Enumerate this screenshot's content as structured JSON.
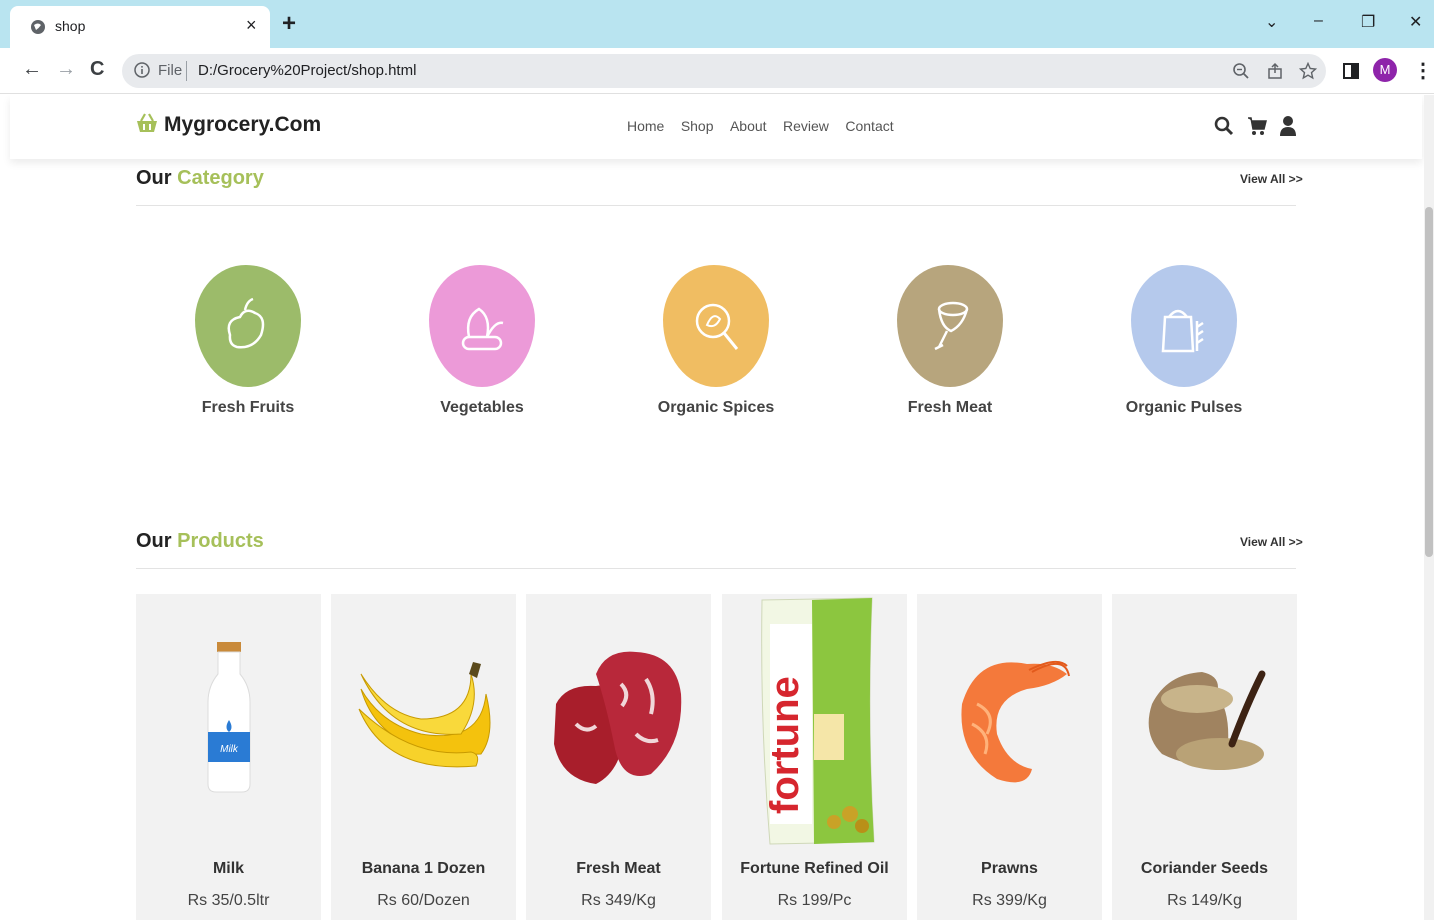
{
  "browser": {
    "tab_title": "shop",
    "address_prefix": "File",
    "url": "D:/Grocery%20Project/shop.html",
    "profile_initial": "M"
  },
  "site": {
    "logo": "Mygrocery.Com",
    "menu": [
      "Home",
      "Shop",
      "About",
      "Review",
      "Contact"
    ]
  },
  "category_section": {
    "title": "Our",
    "title_accent": "Category",
    "view_all": "View All >>",
    "items": [
      {
        "name": "Fresh Fruits",
        "color": "#9cbb6a",
        "icon": "fruit-icon"
      },
      {
        "name": "Vegetables",
        "color": "#ec9ad8",
        "icon": "vegetable-icon"
      },
      {
        "name": "Organic Spices",
        "color": "#f0bd62",
        "icon": "spice-icon"
      },
      {
        "name": "Fresh Meat",
        "color": "#b7a57d",
        "icon": "meat-icon"
      },
      {
        "name": "Organic Pulses",
        "color": "#b5c9ec",
        "icon": "pulse-icon"
      }
    ]
  },
  "products_section": {
    "title": "Our",
    "title_accent": "Products",
    "view_all": "View All >>",
    "items": [
      {
        "name": "Milk",
        "price": "Rs 35/0.5ltr",
        "image": "milk-bottle-icon"
      },
      {
        "name": "Banana 1 Dozen",
        "price": "Rs 60/Dozen",
        "image": "banana-icon"
      },
      {
        "name": "Fresh Meat",
        "price": "Rs 349/Kg",
        "image": "meat-icon"
      },
      {
        "name": "Fortune Refined Oil",
        "price": "Rs 199/Pc",
        "image": "oil-pack-icon",
        "label": "fortune"
      },
      {
        "name": "Prawns",
        "price": "Rs 399/Kg",
        "image": "prawn-icon"
      },
      {
        "name": "Coriander Seeds",
        "price": "Rs 149/Kg",
        "image": "seeds-sack-icon"
      }
    ]
  },
  "colors": {
    "accent": "#a6c05a",
    "tabbar": "#b9e4f0"
  }
}
